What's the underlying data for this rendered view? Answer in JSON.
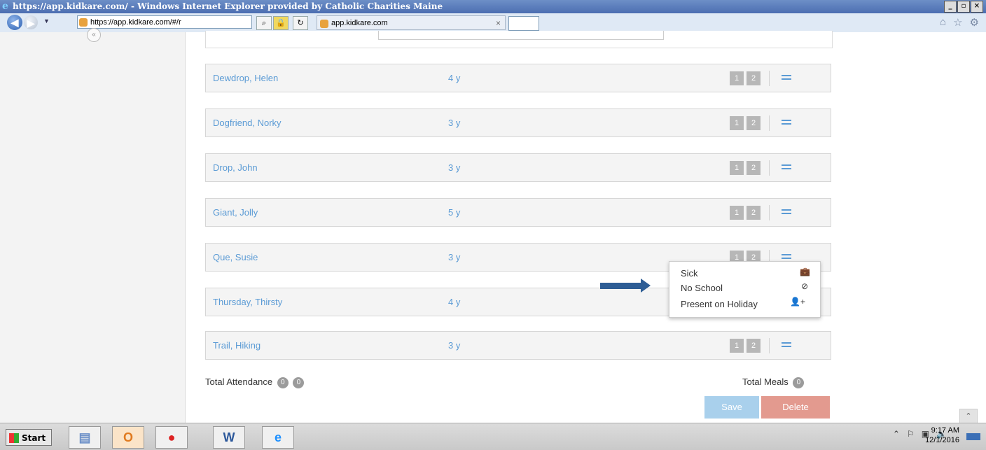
{
  "browser": {
    "window_title": "https://app.kidkare.com/ - Windows Internet Explorer provided by Catholic Charities Maine",
    "address": "https://app.kidkare.com/#/r",
    "tab_label": "app.kidkare.com",
    "tab_close": "×"
  },
  "children": [
    {
      "name": "Dewdrop, Helen",
      "age": "4 y"
    },
    {
      "name": "Dogfriend, Norky",
      "age": "3 y"
    },
    {
      "name": "Drop, John",
      "age": "3 y"
    },
    {
      "name": "Giant, Jolly",
      "age": "5 y"
    },
    {
      "name": "Que, Susie",
      "age": "3 y"
    },
    {
      "name": "Thursday, Thirsty",
      "age": "4 y"
    },
    {
      "name": "Trail, Hiking",
      "age": "3 y"
    }
  ],
  "row_buttons": {
    "one": "1",
    "two": "2"
  },
  "dropdown": {
    "sick": "Sick",
    "no_school": "No School",
    "present_on_holiday": "Present on Holiday"
  },
  "totals": {
    "attendance_label": "Total Attendance",
    "attendance_a": "0",
    "attendance_b": "0",
    "meals_label": "Total Meals",
    "meals": "0"
  },
  "actions": {
    "save": "Save",
    "delete": "Delete"
  },
  "taskbar": {
    "start": "Start",
    "time": "9:17 AM",
    "date": "12/1/2016"
  },
  "colors": {
    "accent": "#5b9bd5",
    "save": "#a9d0ec",
    "delete": "#e39a8f",
    "arrow": "#2e5d95"
  }
}
